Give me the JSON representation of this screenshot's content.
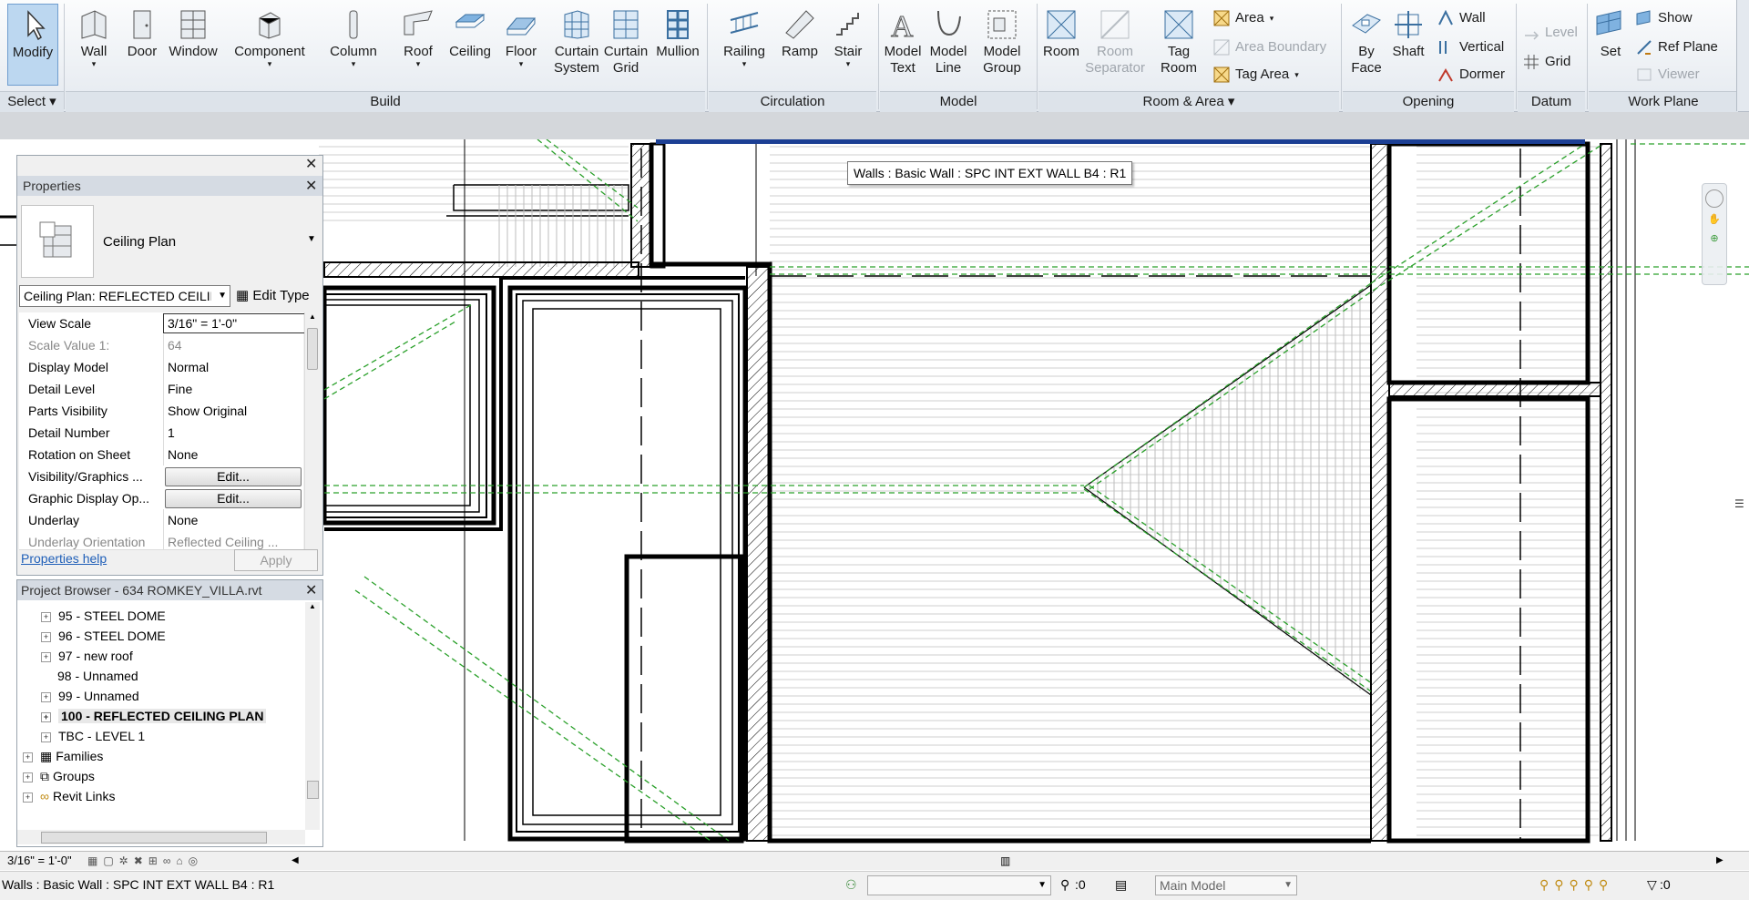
{
  "ribbon": {
    "modify": "Modify",
    "select": "Select",
    "build": {
      "wall": "Wall",
      "door": "Door",
      "window": "Window",
      "component": "Component",
      "column": "Column",
      "roof": "Roof",
      "ceiling": "Ceiling",
      "floor": "Floor",
      "curtain_system": "Curtain\nSystem",
      "curtain_grid": "Curtain\nGrid",
      "mullion": "Mullion",
      "panel": "Build"
    },
    "circulation": {
      "railing": "Railing",
      "ramp": "Ramp",
      "stair": "Stair",
      "panel": "Circulation"
    },
    "model": {
      "model_text": "Model\nText",
      "model_line": "Model\nLine",
      "model_group": "Model\nGroup",
      "panel": "Model"
    },
    "room_area": {
      "room": "Room",
      "room_separator": "Room\nSeparator",
      "tag_room": "Tag\nRoom",
      "area": "Area",
      "area_boundary": "Area  Boundary",
      "tag_area": "Tag  Area",
      "panel": "Room & Area"
    },
    "opening": {
      "by_face": "By\nFace",
      "shaft": "Shaft",
      "wall": "Wall",
      "vertical": "Vertical",
      "dormer": "Dormer",
      "panel": "Opening"
    },
    "datum": {
      "level": "Level",
      "grid": "Grid",
      "panel": "Datum"
    },
    "work_plane": {
      "set": "Set",
      "show": "Show",
      "ref_plane": "Ref  Plane",
      "viewer": "Viewer",
      "panel": "Work Plane"
    }
  },
  "tooltip": "Walls : Basic Wall : SPC INT EXT WALL B4 : R1",
  "properties": {
    "title": "Properties",
    "type_name": "Ceiling Plan",
    "instance_selector": "Ceiling Plan: REFLECTED CEILIN",
    "edit_type": "Edit Type",
    "rows": [
      {
        "k": "View Scale",
        "v": "3/16\" = 1'-0\""
      },
      {
        "k": "Scale Value    1:",
        "v": "64"
      },
      {
        "k": "Display Model",
        "v": "Normal"
      },
      {
        "k": "Detail Level",
        "v": "Fine"
      },
      {
        "k": "Parts Visibility",
        "v": "Show Original"
      },
      {
        "k": "Detail Number",
        "v": "1"
      },
      {
        "k": "Rotation on Sheet",
        "v": "None"
      },
      {
        "k": "Visibility/Graphics ...",
        "v": "Edit..."
      },
      {
        "k": "Graphic Display Op...",
        "v": "Edit..."
      },
      {
        "k": "Underlay",
        "v": "None"
      },
      {
        "k": "Underlay Orientation",
        "v": "Reflected Ceiling ..."
      }
    ],
    "help": "Properties help",
    "apply": "Apply"
  },
  "browser": {
    "title": "Project Browser - 634 ROMKEY_VILLA.rvt",
    "items": [
      {
        "label": "95 - STEEL DOME",
        "bold": false
      },
      {
        "label": "96 - STEEL DOME",
        "bold": false
      },
      {
        "label": "97 - new roof",
        "bold": false
      },
      {
        "label": "98 - Unnamed",
        "bold": false
      },
      {
        "label": "99 - Unnamed",
        "bold": false
      },
      {
        "label": "100 - REFLECTED CEILING PLAN",
        "bold": true
      },
      {
        "label": "TBC - LEVEL 1",
        "bold": false
      }
    ],
    "groups": [
      "Families",
      "Groups",
      "Revit Links"
    ]
  },
  "viewbar": {
    "scale": "3/16\" = 1'-0\""
  },
  "status": {
    "text": "Walls : Basic Wall : SPC INT EXT WALL B4 : R1",
    "count": ":0",
    "model": "Main Model",
    "filter": ":0"
  }
}
